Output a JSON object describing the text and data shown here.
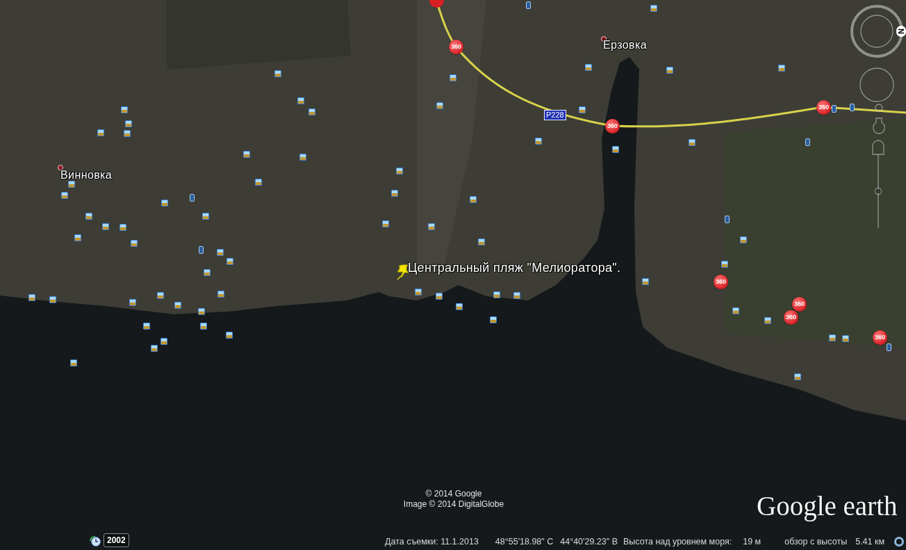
{
  "map": {
    "places": [
      {
        "name": "Винновка"
      },
      {
        "name": "Ерзовка"
      }
    ],
    "placemark": {
      "label": "Центральный пляж \"Мелиоратора\"."
    },
    "road_sign": "Р228",
    "panorama_markers": [
      "360",
      "360",
      "360",
      "360",
      "360",
      "360",
      "360"
    ]
  },
  "navigation": {
    "north_label": "N",
    "zoom_slider": {
      "level": 0.5
    }
  },
  "attribution": [
    "© 2014 Google",
    "Image © 2014 DigitalGlobe"
  ],
  "logo": "Google earth",
  "historical_imagery": {
    "year": "2002"
  },
  "status_bar": {
    "imagery_date": "Дата съемки: 11.1.2013",
    "latitude": "48°55'18.98\" С",
    "longitude": "44°40'29.23\" В",
    "elevation_label": "Высота над уровнем моря:",
    "elevation": "19 м",
    "eye_altitude_label": "обзор с высоты",
    "eye_altitude": "5.41 км"
  }
}
